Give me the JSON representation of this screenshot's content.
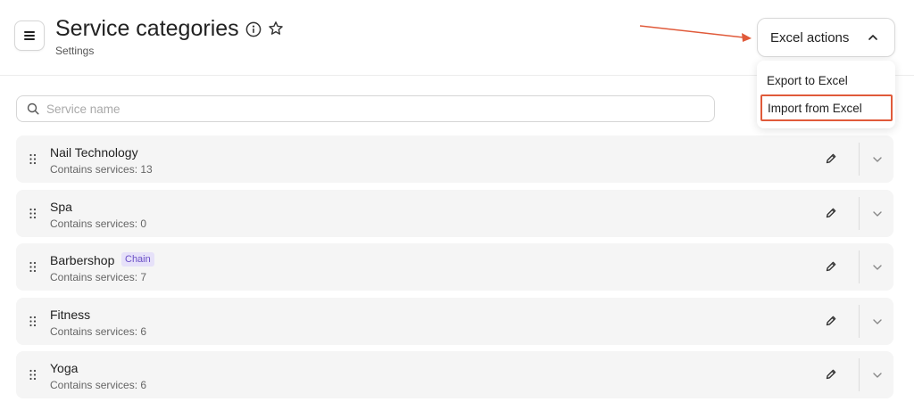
{
  "header": {
    "title": "Service categories",
    "subtitle": "Settings",
    "icons": {
      "menu": "hamburger-icon",
      "info": "info-icon",
      "favorite": "star-icon"
    }
  },
  "excel": {
    "button_label": "Excel actions",
    "menu_items": [
      {
        "label": "Export to Excel"
      },
      {
        "label": "Import from Excel",
        "highlighted": true
      }
    ],
    "highlight_color": "#e05a3a"
  },
  "search": {
    "placeholder": "Service name",
    "value": ""
  },
  "categories": [
    {
      "name": "Nail Technology",
      "count_text": "Contains services: 13",
      "badge": ""
    },
    {
      "name": "Spa",
      "count_text": "Contains services: 0",
      "badge": ""
    },
    {
      "name": "Barbershop",
      "count_text": "Contains services: 7",
      "badge": "Chain"
    },
    {
      "name": "Fitness",
      "count_text": "Contains services: 6",
      "badge": ""
    },
    {
      "name": "Yoga",
      "count_text": "Contains services: 6",
      "badge": ""
    }
  ],
  "colors": {
    "row_bg": "#f5f5f5",
    "badge_text": "#6a4fc6",
    "badge_bg": "#e6e1f9"
  }
}
